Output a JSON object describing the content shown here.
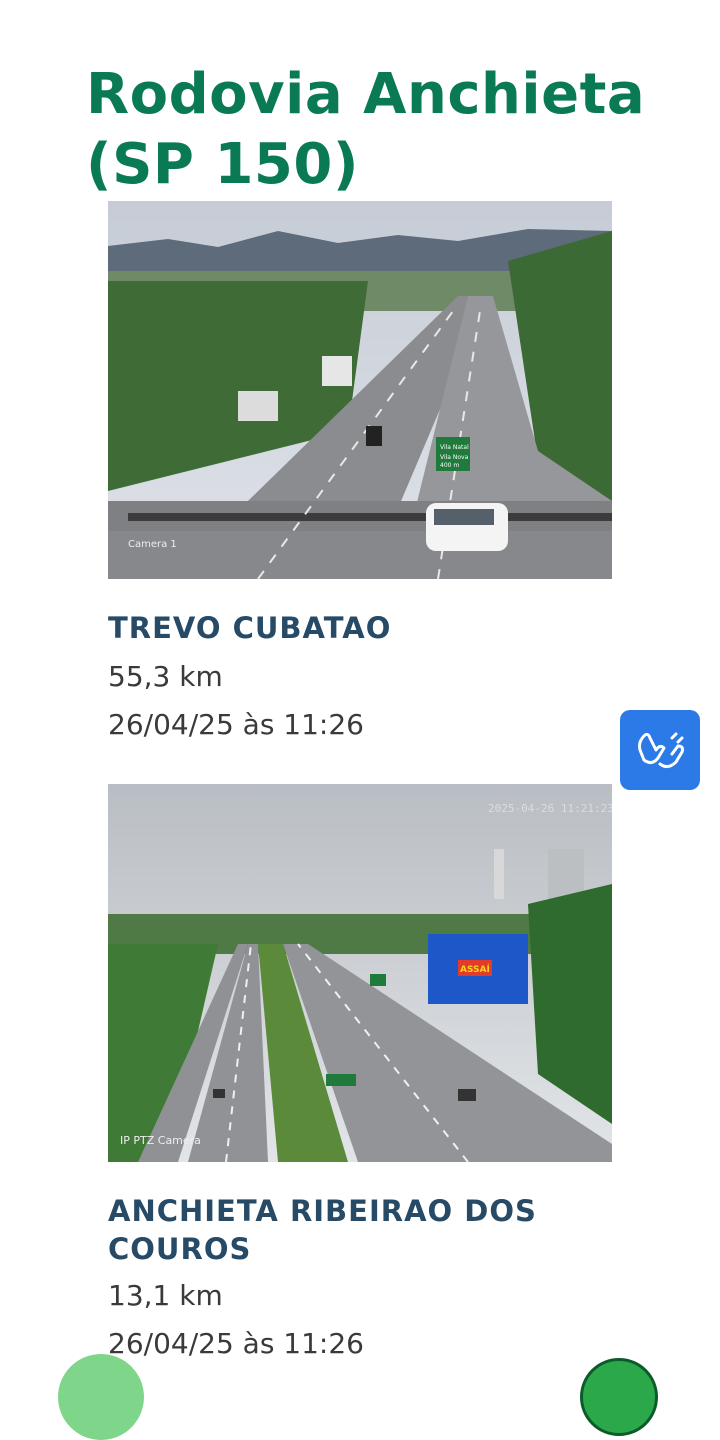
{
  "page": {
    "title": "Rodovia Anchieta (SP 150)"
  },
  "cameras": [
    {
      "name": "TREVO CUBATAO",
      "km": "55,3 km",
      "updated": "26/04/25 às 11:26",
      "overlay_label": "Camera 1",
      "sign_text": [
        "Vila Natal",
        "Vila Nova",
        "400 m"
      ]
    },
    {
      "name": "ANCHIETA RIBEIRAO DOS COUROS",
      "km": "13,1 km",
      "updated": "26/04/25 às 11:26",
      "overlay_label": "IP PTZ Camera",
      "overlay_timestamp": "2025-04-26 11:21:23",
      "store_sign": "ASSAÍ"
    }
  ],
  "icons": {
    "accessibility": "sign-language-hands-icon"
  },
  "colors": {
    "title": "#0a7a55",
    "camera_name": "#274a66",
    "accessibility_bg": "#2b7ae8"
  }
}
